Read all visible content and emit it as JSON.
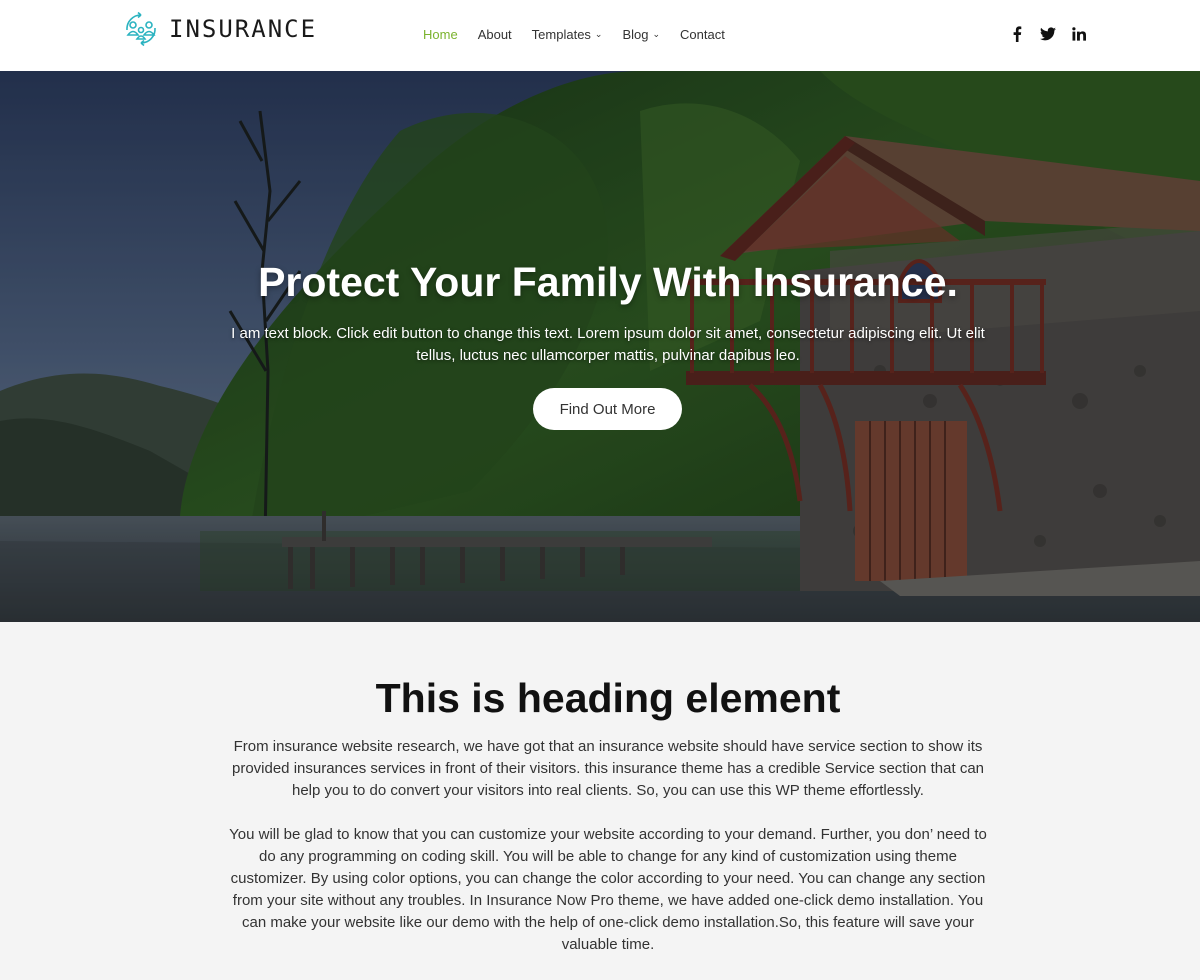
{
  "brand": {
    "logo_text": "INSURANCE",
    "accent_color": "#7bb32e",
    "logo_color": "#2bb3c0"
  },
  "nav": {
    "items": [
      {
        "label": "Home",
        "active": true,
        "has_dropdown": false
      },
      {
        "label": "About",
        "active": false,
        "has_dropdown": false
      },
      {
        "label": "Templates",
        "active": false,
        "has_dropdown": true
      },
      {
        "label": "Blog",
        "active": false,
        "has_dropdown": true
      },
      {
        "label": "Contact",
        "active": false,
        "has_dropdown": false
      }
    ]
  },
  "social": {
    "icons": [
      "facebook-icon",
      "twitter-icon",
      "linkedin-icon"
    ]
  },
  "hero": {
    "title": "Protect Your Family With Insurance.",
    "text": "I am text block. Click edit button to change this text. Lorem ipsum dolor sit amet, consectetur adipiscing elit. Ut elit tellus, luctus nec ullamcorper mattis, pulvinar dapibus leo.",
    "button_label": "Find Out More"
  },
  "content": {
    "heading": "This is heading element",
    "paragraph_1": "From insurance website research, we have got that an insurance website should have service section to show its provided insurances services in front of their visitors. this insurance theme has a credible Service section that can help you to do convert your visitors into real clients. So, you can use this WP theme effortlessly.",
    "paragraph_2": "You will be glad to know that you can customize your website according to your demand. Further, you don’ need to do any programming on coding skill.  You will be able to change for any kind of customization using theme customizer. By using color options, you can change the color according to your need. You can change any section from your site without any troubles. In Insurance Now Pro theme, we have added one-click demo installation. You can make your website like our demo with the help of one-click demo installation.So, this feature will save your valuable time."
  }
}
